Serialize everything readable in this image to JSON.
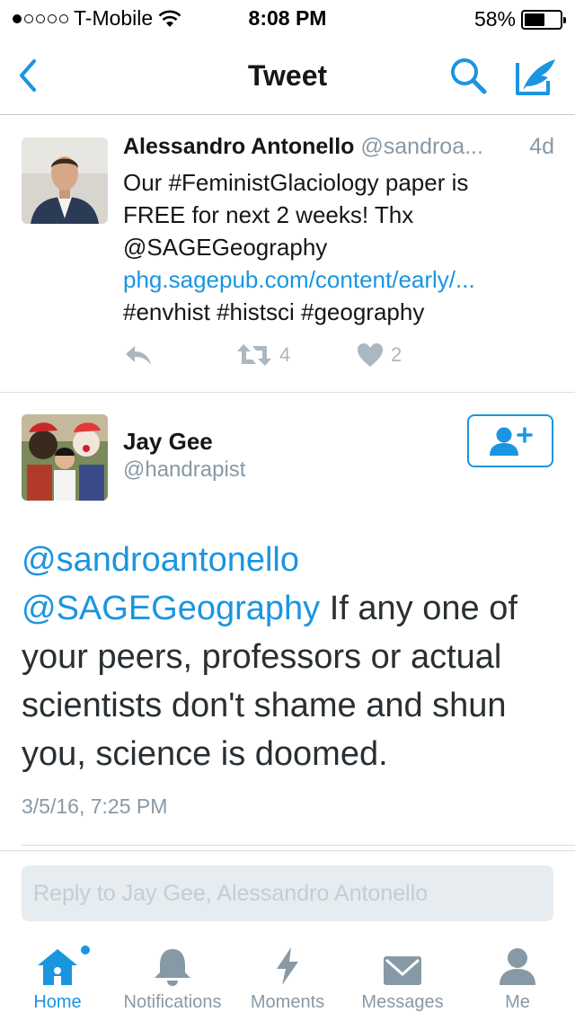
{
  "status_bar": {
    "carrier": "T-Mobile",
    "time": "8:08 PM",
    "battery": "58%",
    "battery_level": 0.58
  },
  "nav": {
    "title": "Tweet"
  },
  "parent_tweet": {
    "name": "Alessandro Antonello",
    "handle": "@sandroa...",
    "time": "4d",
    "line1": "Our #FeministGlaciology paper is",
    "line2": "FREE for next 2 weeks! Thx",
    "line3": "@SAGEGeography",
    "link": "phg.sagepub.com/content/early/...",
    "line5": "#envhist #histsci #geography",
    "retweets": "4",
    "likes": "2"
  },
  "main_tweet": {
    "name": "Jay Gee",
    "handle": "@handrapist",
    "mention1": "@sandroantonello",
    "mention2": "@SAGEGeography",
    "text": " If any one of your peers, professors or actual scientists don't shame and shun you, science is doomed.",
    "date": "3/5/16, 7:25 PM"
  },
  "reply": {
    "placeholder": "Reply to Jay Gee, Alessandro Antonello"
  },
  "tabs": [
    {
      "label": "Home",
      "icon": "home-icon"
    },
    {
      "label": "Notifications",
      "icon": "bell-icon"
    },
    {
      "label": "Moments",
      "icon": "lightning-icon"
    },
    {
      "label": "Messages",
      "icon": "envelope-icon"
    },
    {
      "label": "Me",
      "icon": "person-icon"
    }
  ],
  "colors": {
    "accent": "#1b95e0",
    "muted": "#8899a6",
    "icon_gray": "#aab8c2"
  }
}
